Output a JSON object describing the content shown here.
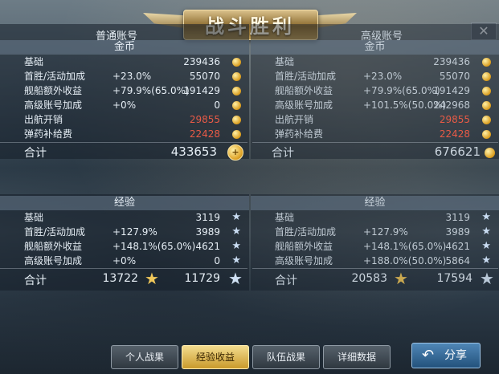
{
  "header": {
    "title": "战斗胜利",
    "close_label": "✕"
  },
  "left": {
    "account": "普通账号",
    "gold": {
      "section": "金币",
      "rows": [
        {
          "label": "基础",
          "pct": "",
          "value": "239436",
          "red": false
        },
        {
          "label": "首胜/活动加成",
          "pct": "+23.0%",
          "value": "55070",
          "red": false
        },
        {
          "label": "舰船额外收益",
          "pct": "+79.9%(65.0%)",
          "value": "191429",
          "red": false
        },
        {
          "label": "高级账号加成",
          "pct": "+0%",
          "value": "0",
          "red": false
        },
        {
          "label": "出航开销",
          "pct": "",
          "value": "29855",
          "red": true
        },
        {
          "label": "弹药补给费",
          "pct": "",
          "value": "22428",
          "red": true
        }
      ],
      "total_label": "合计",
      "total": "433653"
    },
    "exp": {
      "section": "经验",
      "rows": [
        {
          "label": "基础",
          "pct": "",
          "value": "3119"
        },
        {
          "label": "首胜/活动加成",
          "pct": "+127.9%",
          "value": "3989"
        },
        {
          "label": "舰船额外收益",
          "pct": "+148.1%(65.0%)",
          "value": "4621"
        },
        {
          "label": "高级账号加成",
          "pct": "+0%",
          "value": "0"
        }
      ],
      "total_label": "合计",
      "total_a": "13722",
      "total_b": "11729"
    }
  },
  "right": {
    "account": "高级账号",
    "gold": {
      "section": "金币",
      "rows": [
        {
          "label": "基础",
          "pct": "",
          "value": "239436",
          "red": false
        },
        {
          "label": "首胜/活动加成",
          "pct": "+23.0%",
          "value": "55070",
          "red": false
        },
        {
          "label": "舰船额外收益",
          "pct": "+79.9%(65.0%)",
          "value": "191429",
          "red": false
        },
        {
          "label": "高级账号加成",
          "pct": "+101.5%(50.0%)",
          "value": "242968",
          "red": false
        },
        {
          "label": "出航开销",
          "pct": "",
          "value": "29855",
          "red": true
        },
        {
          "label": "弹药补给费",
          "pct": "",
          "value": "22428",
          "red": true
        }
      ],
      "total_label": "合计",
      "total": "676621"
    },
    "exp": {
      "section": "经验",
      "rows": [
        {
          "label": "基础",
          "pct": "",
          "value": "3119"
        },
        {
          "label": "首胜/活动加成",
          "pct": "+127.9%",
          "value": "3989"
        },
        {
          "label": "舰船额外收益",
          "pct": "+148.1%(65.0%)",
          "value": "4621"
        },
        {
          "label": "高级账号加成",
          "pct": "+188.0%(50.0%)",
          "value": "5864"
        }
      ],
      "total_label": "合计",
      "total_a": "20583",
      "total_b": "17594"
    }
  },
  "tabs": [
    "个人战果",
    "经验收益",
    "队伍战果",
    "详细数据"
  ],
  "active_tab": 1,
  "share_label": "分享",
  "icons": {
    "coin": "gold-coin-icon",
    "star": "star-icon",
    "share": "share-arrow-icon"
  },
  "colors": {
    "negative": "#e85a46",
    "active_tab": "#e6c060",
    "share": "#3a6f9c"
  }
}
